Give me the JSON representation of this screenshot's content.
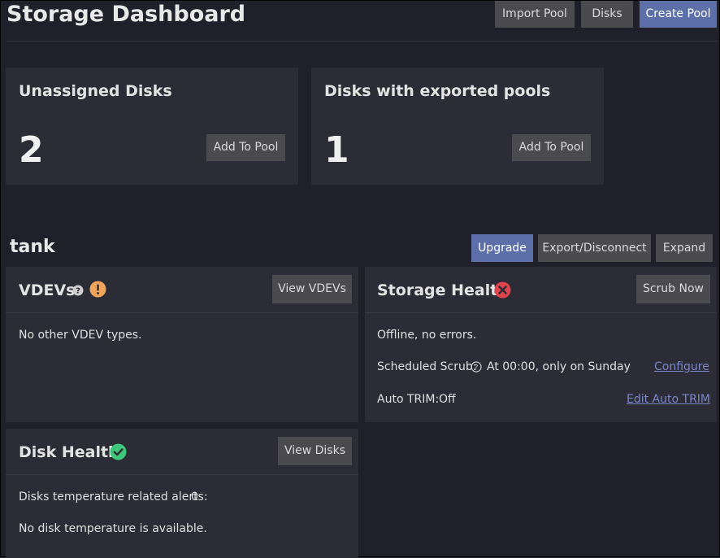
{
  "header": {
    "title": "Storage Dashboard",
    "import_pool": "Import Pool",
    "disks": "Disks",
    "create_pool": "Create Pool"
  },
  "unassigned": {
    "title": "Unassigned Disks",
    "count": "2",
    "button": "Add To Pool"
  },
  "exported": {
    "title": "Disks with exported pools",
    "count": "1",
    "button": "Add To Pool"
  },
  "pool": {
    "name": "tank",
    "upgrade": "Upgrade",
    "export": "Export/Disconnect",
    "expand": "Expand"
  },
  "vdevs": {
    "title": "VDEVs",
    "button": "View VDEVs",
    "body": "No other VDEV types.",
    "status_icon": "warning-icon"
  },
  "storage_health": {
    "title": "Storage Health",
    "button": "Scrub Now",
    "status": "Offline, no errors.",
    "scrub_label": "Scheduled Scrub:",
    "scrub_value": "At 00:00, only on Sunday",
    "configure": "Configure",
    "trim_label": "Auto TRIM:",
    "trim_value": "Off",
    "edit_trim": "Edit Auto TRIM",
    "status_icon": "error-icon"
  },
  "disk_health": {
    "title": "Disk Health",
    "button": "View Disks",
    "alerts_label": "Disks temperature related alerts:",
    "alerts_value": "0",
    "temp_text": "No disk temperature is available.",
    "status_icon": "check-icon"
  },
  "colors": {
    "background": "#1f2029",
    "card": "#2b2c35",
    "primary": "#5d6fa8",
    "warning": "#f0a45c",
    "error": "#e0434b",
    "success": "#3fc67a",
    "link": "#7a87c9"
  }
}
